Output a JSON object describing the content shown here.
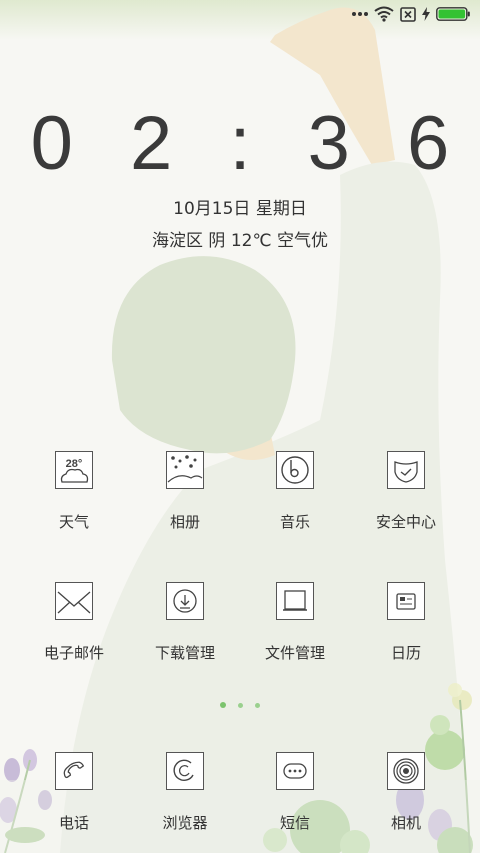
{
  "status_bar": {
    "icons": [
      "more-dots-icon",
      "wifi-icon",
      "no-sim-icon",
      "charging-bolt-icon",
      "battery-icon"
    ],
    "battery_level": 1.0,
    "accent_color": "#33c233"
  },
  "lockscreen": {
    "time": "0 2 : 3 6",
    "date": "10月15日 星期日",
    "weather": "海淀区 阴 12℃ 空气优"
  },
  "apps_row1": [
    {
      "label": "天气",
      "icon": "weather-icon",
      "temp": "28°"
    },
    {
      "label": "相册",
      "icon": "gallery-icon"
    },
    {
      "label": "音乐",
      "icon": "music-icon"
    },
    {
      "label": "安全中心",
      "icon": "security-icon"
    }
  ],
  "apps_row2": [
    {
      "label": "电子邮件",
      "icon": "mail-icon"
    },
    {
      "label": "下载管理",
      "icon": "download-icon"
    },
    {
      "label": "文件管理",
      "icon": "file-manager-icon"
    },
    {
      "label": "日历",
      "icon": "calendar-icon"
    }
  ],
  "page_indicator": {
    "pages": 3,
    "active": 0
  },
  "dock": [
    {
      "label": "电话",
      "icon": "phone-icon"
    },
    {
      "label": "浏览器",
      "icon": "browser-icon"
    },
    {
      "label": "短信",
      "icon": "sms-icon"
    },
    {
      "label": "相机",
      "icon": "camera-icon"
    }
  ]
}
